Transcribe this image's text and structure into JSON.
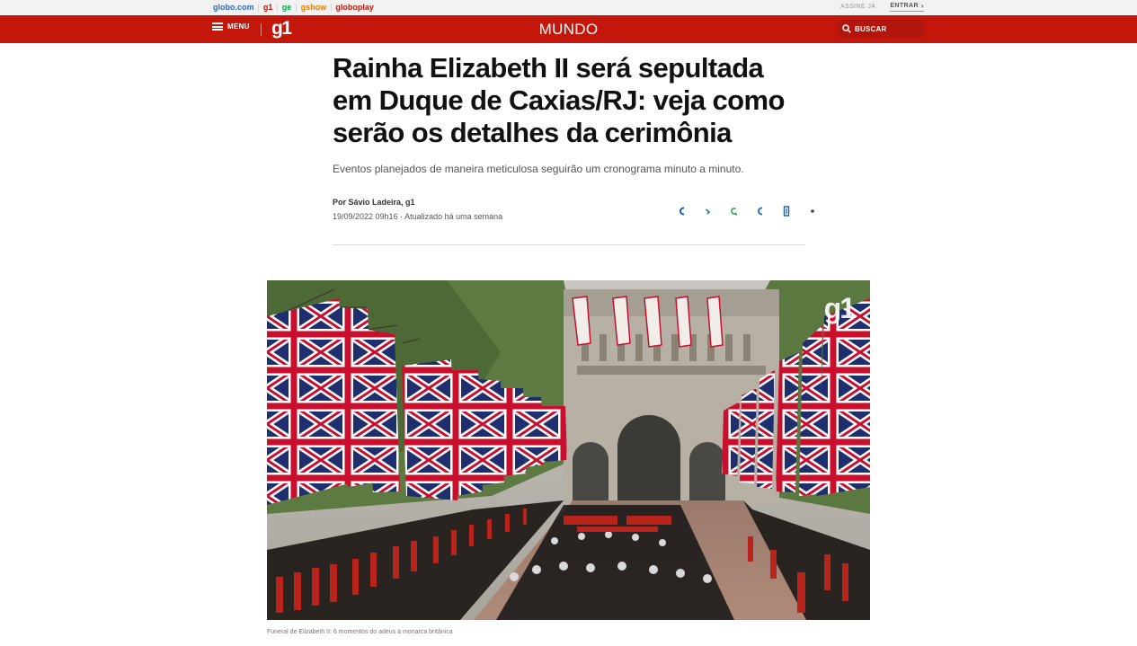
{
  "globobar": {
    "brands": [
      {
        "label": "globo.com",
        "color": "#2d6ac9"
      },
      {
        "label": "g1",
        "color": "#c4170c"
      },
      {
        "label": "ge",
        "color": "#06aa48"
      },
      {
        "label": "gshow",
        "color": "#f27d00"
      },
      {
        "label": "globoplay",
        "color": "#c4170c"
      }
    ],
    "assine": "ASSINE JÁ",
    "entrar": "ENTRAR"
  },
  "header": {
    "menu_label": "MENU",
    "logo": "g1",
    "section": "MUNDO",
    "search_label": "BUSCAR",
    "color": "#c4170c"
  },
  "article": {
    "title": "Rainha Elizabeth II será sepultada em Duque de Caxias/RJ: veja como serão os detalhes da cerimônia",
    "subtitle": "Eventos planejados de maneira meticulosa seguirão um cronograma minuto a minuto.",
    "author": "Por Sávio Ladeira, g1",
    "date": "19/09/2022 09h16 · Atualizado há uma semana",
    "share_icons": [
      "facebook-icon",
      "twitter-icon",
      "whatsapp-icon",
      "telegram-icon",
      "linkedin-icon",
      "more-icon"
    ]
  },
  "photo": {
    "watermark": "g1",
    "caption": "Funeral de Elizabeth II: 6 momentos do adeus à monarca britânica"
  }
}
